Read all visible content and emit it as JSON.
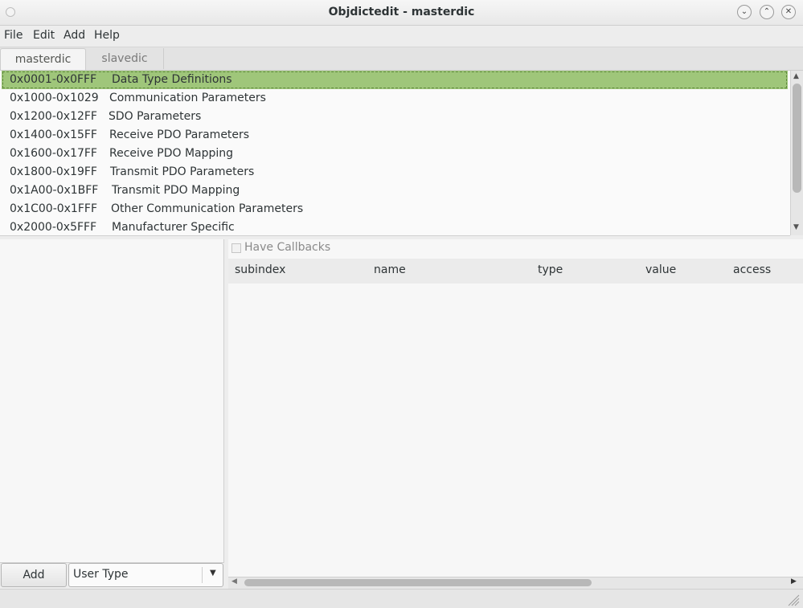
{
  "window": {
    "title": "Objdictedit - masterdic",
    "controls": [
      "minimize-icon",
      "maximize-icon",
      "close-icon"
    ]
  },
  "menu": {
    "items": [
      "File",
      "Edit",
      "Add",
      "Help"
    ]
  },
  "tabs": [
    {
      "label": "masterdic",
      "active": true
    },
    {
      "label": "slavedic",
      "active": false
    }
  ],
  "index_list": {
    "rows": [
      {
        "range": "0x0001-0x0FFF",
        "desc": "Data Type Definitions",
        "selected": true
      },
      {
        "range": "0x1000-0x1029",
        "desc": "Communication Parameters"
      },
      {
        "range": "0x1200-0x12FF",
        "desc": "SDO Parameters"
      },
      {
        "range": "0x1400-0x15FF",
        "desc": "Receive PDO Parameters"
      },
      {
        "range": "0x1600-0x17FF",
        "desc": "Receive PDO Mapping"
      },
      {
        "range": "0x1800-0x19FF",
        "desc": "Transmit PDO Parameters"
      },
      {
        "range": "0x1A00-0x1BFF",
        "desc": "Transmit PDO Mapping"
      },
      {
        "range": "0x1C00-0x1FFF",
        "desc": "Other Communication Parameters"
      },
      {
        "range": "0x2000-0x5FFF",
        "desc": "Manufacturer Specific"
      }
    ]
  },
  "left_panel": {
    "add_label": "Add",
    "type_select_value": "User Type"
  },
  "right_panel": {
    "callbacks_label": "Have Callbacks",
    "columns": [
      "subindex",
      "name",
      "type",
      "value",
      "access"
    ]
  },
  "colors": {
    "selection": "#9fc67a",
    "background": "#ededed"
  }
}
